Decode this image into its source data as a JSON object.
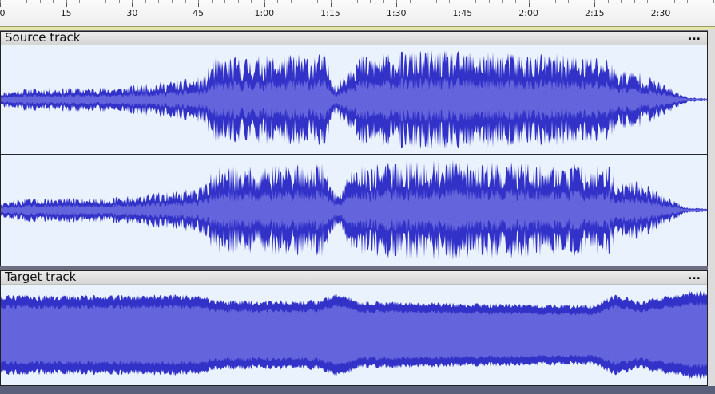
{
  "ruler": {
    "labels": [
      "0",
      "15",
      "30",
      "45",
      "1:00",
      "1:15",
      "1:30",
      "1:45",
      "2:00",
      "2:15",
      "2:30"
    ]
  },
  "tracks": [
    {
      "name": "Source track",
      "menu_label": "...",
      "channels": 2,
      "wave_color": "#3232c8",
      "rms_color": "#6464dc"
    },
    {
      "name": "Target track",
      "menu_label": "...",
      "channels": 1,
      "wave_color": "#3232c8",
      "rms_color": "#6464dc"
    }
  ],
  "colors": {
    "track_background": "#eaf3fd",
    "ruler_background": "#f4f4f4",
    "play_region": "#e3e6a8",
    "window_background": "#6e6e80"
  }
}
